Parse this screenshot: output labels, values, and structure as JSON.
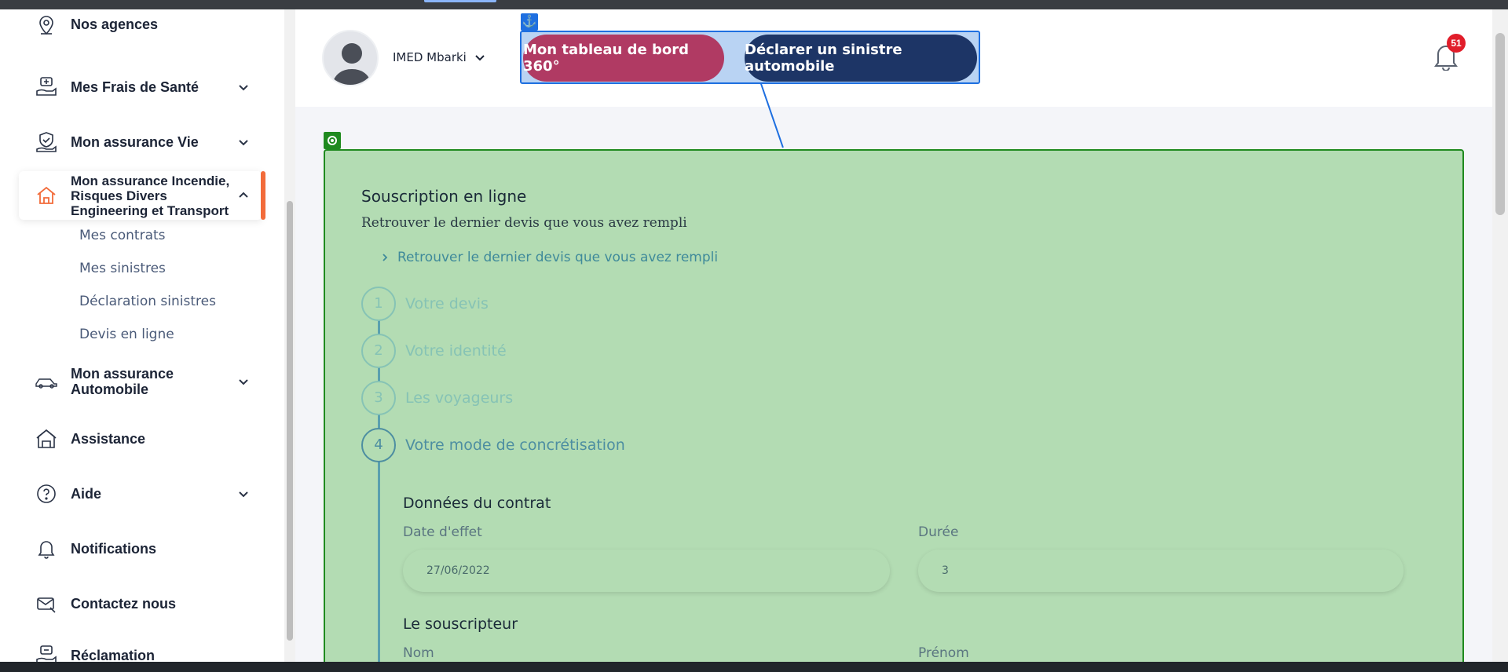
{
  "sidebar": {
    "items": [
      {
        "label": "Nos agences",
        "icon": "location-pin-icon"
      },
      {
        "label": "Mes Frais de Santé",
        "icon": "health-fees-icon"
      },
      {
        "label": "Mon assurance Vie",
        "icon": "life-insurance-icon"
      },
      {
        "label": "Mon assurance Incendie, Risques Divers Engineering et Transport",
        "icon": "home-icon"
      },
      {
        "label": "Mon assurance Automobile",
        "icon": "car-icon"
      },
      {
        "label": "Assistance",
        "icon": "assistance-icon"
      },
      {
        "label": "Aide",
        "icon": "help-icon"
      },
      {
        "label": "Notifications",
        "icon": "bell-icon"
      },
      {
        "label": "Contactez nous",
        "icon": "mail-icon"
      },
      {
        "label": "Réclamation",
        "icon": "complaint-icon"
      }
    ],
    "subitems": [
      "Mes contrats",
      "Mes sinistres",
      "Déclaration sinistres",
      "Devis en ligne"
    ]
  },
  "header": {
    "user_name": "IMED Mbarki",
    "btn_dashboard": "Mon tableau de bord 360°",
    "btn_claim": "Déclarer un sinistre automobile",
    "notifications_count": "51"
  },
  "main": {
    "title": "Souscription en ligne",
    "subtitle": "Retrouver le dernier devis que vous avez rempli",
    "retrieve_link": "Retrouver le dernier devis que vous avez rempli",
    "steps": [
      {
        "num": "1",
        "label": "Votre devis"
      },
      {
        "num": "2",
        "label": "Votre identité"
      },
      {
        "num": "3",
        "label": "Les voyageurs"
      },
      {
        "num": "4",
        "label": "Votre mode de concrétisation"
      }
    ],
    "contract": {
      "title": "Données du contrat",
      "date_label": "Date d'effet",
      "date_value": "27/06/2022",
      "duration_label": "Durée",
      "duration_value": "3"
    },
    "subscriber": {
      "title": "Le souscripteur",
      "nom_label": "Nom",
      "prenom_label": "Prénom"
    }
  },
  "colors": {
    "accent_orange": "#f26b3a",
    "btn_dashboard": "#b03a63",
    "btn_claim": "#1d3566",
    "overlay_green": "#b3dcb3",
    "overlay_blue": "#b9d3f3"
  }
}
